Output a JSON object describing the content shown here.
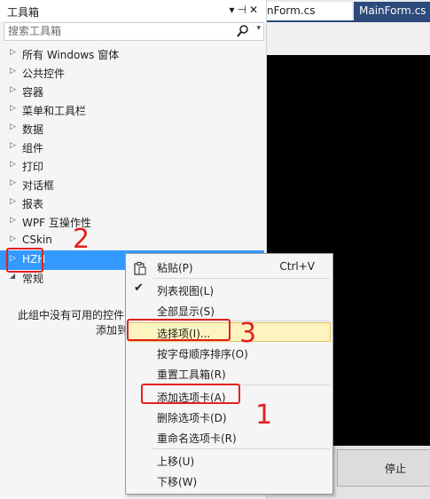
{
  "toolbox": {
    "title": "工具箱",
    "search_placeholder": "搜索工具箱",
    "groups": [
      {
        "label": "所有 Windows 窗体"
      },
      {
        "label": "公共控件"
      },
      {
        "label": "容器"
      },
      {
        "label": "菜单和工具栏"
      },
      {
        "label": "数据"
      },
      {
        "label": "组件"
      },
      {
        "label": "打印"
      },
      {
        "label": "对话框"
      },
      {
        "label": "报表"
      },
      {
        "label": "WPF 互操作性"
      },
      {
        "label": "CSkin"
      },
      {
        "label": "HZH",
        "selected": true
      },
      {
        "label": "常规",
        "expanded": true
      }
    ],
    "empty_message_line1": "此组中没有可用的控件",
    "empty_message_line2": "添加到"
  },
  "editor": {
    "tabs": [
      {
        "label": "nForm.cs"
      },
      {
        "label": "MainForm.cs"
      }
    ],
    "stop_button_label": "停止"
  },
  "context_menu": {
    "items": [
      {
        "label": "粘贴(P)",
        "shortcut": "Ctrl+V",
        "icon": "paste-icon"
      },
      {
        "label": "列表视图(L)",
        "checked": true
      },
      {
        "label": "全部显示(S)"
      },
      {
        "label": "选择项(I)...",
        "highlighted": true
      },
      {
        "label": "按字母顺序排序(O)"
      },
      {
        "label": "重置工具箱(R)"
      },
      {
        "label": "添加选项卡(A)"
      },
      {
        "label": "删除选项卡(D)"
      },
      {
        "label": "重命名选项卡(R)"
      },
      {
        "label": "上移(U)"
      },
      {
        "label": "下移(W)"
      }
    ]
  },
  "annotations": [
    "2",
    "3",
    "1"
  ],
  "colors": {
    "selection": "#3399ff",
    "annotation_red": "#e52020",
    "menu_highlight": "#fdf4bf",
    "active_tab": "#2d4a7a"
  }
}
